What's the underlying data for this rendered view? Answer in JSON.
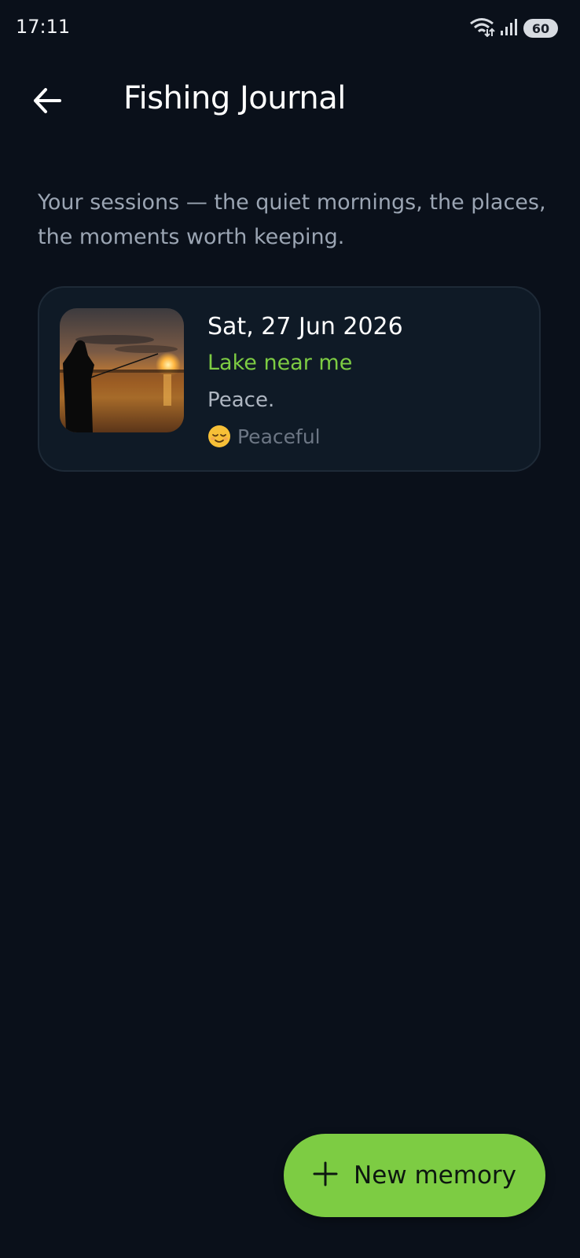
{
  "status_bar": {
    "time": "17:11",
    "battery": "60",
    "icons": [
      "wifi-icon",
      "signal-icon",
      "battery-icon"
    ]
  },
  "header": {
    "back_icon": "arrow-left-icon",
    "title": "Fishing Journal"
  },
  "intro": "Your sessions — the quiet mornings, the places, the moments worth keeping.",
  "sessions": [
    {
      "date": "Sat, 27 Jun 2026",
      "location": "Lake near me",
      "note": "Peace.",
      "mood_icon": "relieved-face-emoji",
      "mood": "Peaceful"
    }
  ],
  "fab": {
    "icon": "plus-icon",
    "label": "New memory"
  },
  "colors": {
    "background": "#0a101a",
    "card": "#0f1a26",
    "accent": "#7dcc43",
    "muted_text": "#9ba5b3"
  }
}
